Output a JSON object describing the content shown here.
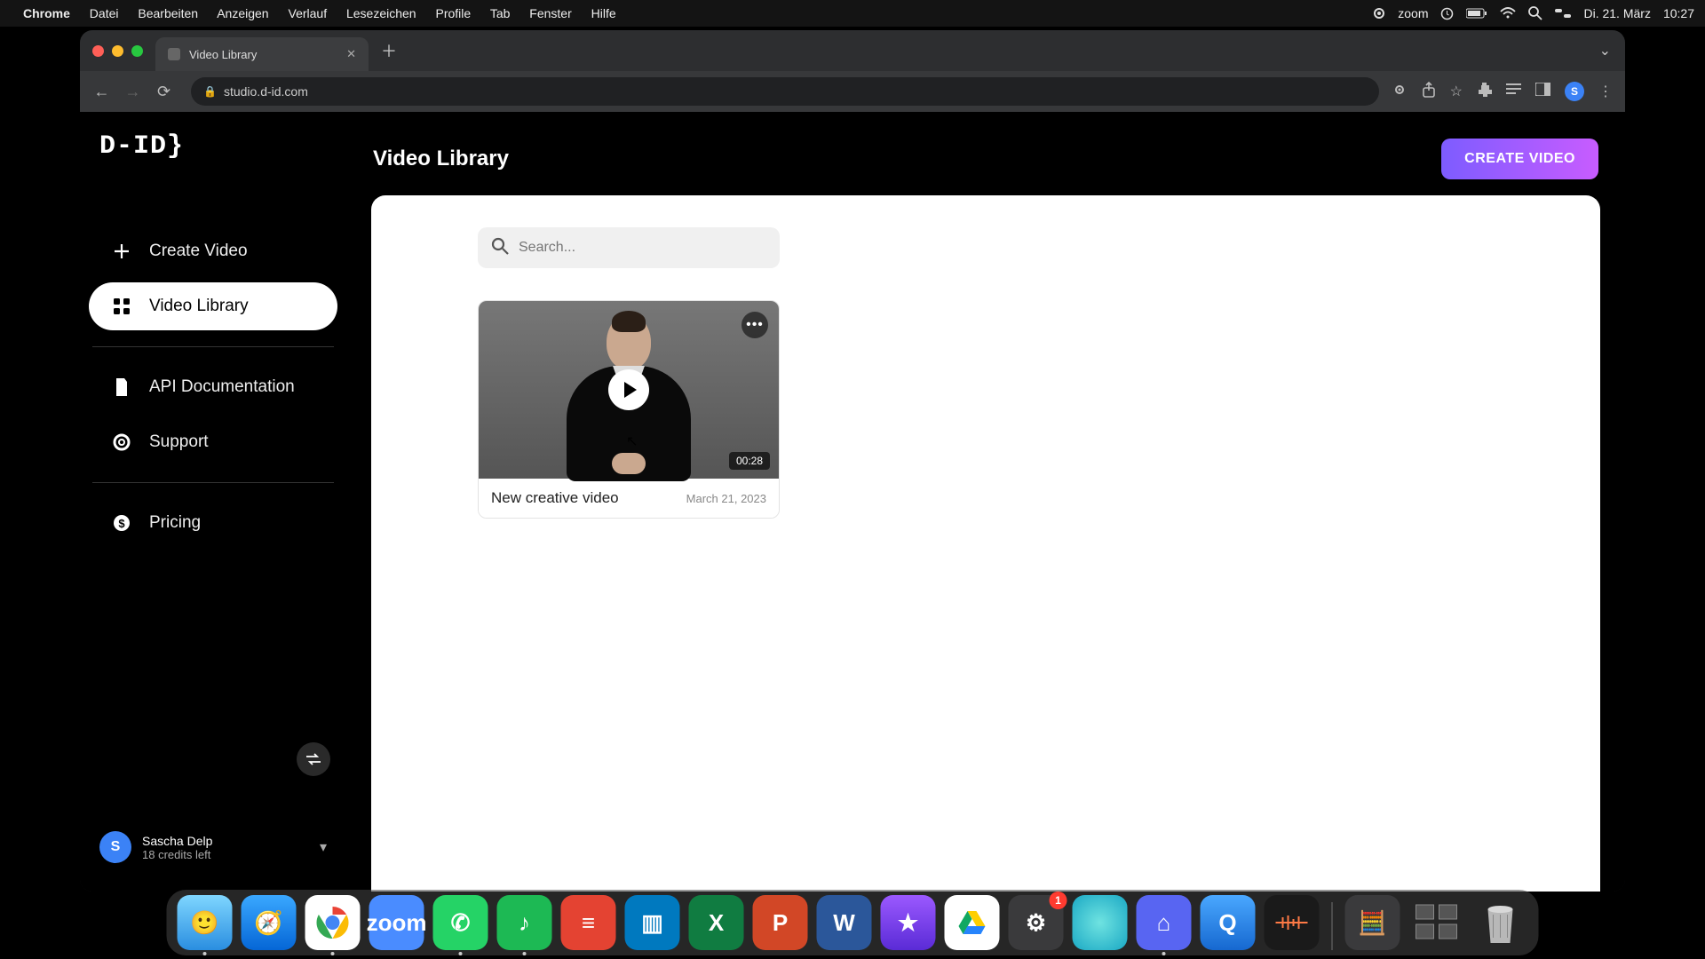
{
  "mac_menu": {
    "app": "Chrome",
    "items": [
      "Datei",
      "Bearbeiten",
      "Anzeigen",
      "Verlauf",
      "Lesezeichen",
      "Profile",
      "Tab",
      "Fenster",
      "Hilfe"
    ],
    "zoom_label": "zoom",
    "date": "Di. 21. März",
    "time": "10:27"
  },
  "browser": {
    "tab_title": "Video Library",
    "url": "studio.d-id.com",
    "avatar_letter": "S"
  },
  "app": {
    "logo": "D-ID}",
    "page_title": "Video Library",
    "create_button": "CREATE VIDEO",
    "nav": {
      "create_video": "Create Video",
      "video_library": "Video Library",
      "api_docs": "API Documentation",
      "support": "Support",
      "pricing": "Pricing"
    },
    "user": {
      "initial": "S",
      "name": "Sascha Delp",
      "credits": "18 credits left"
    },
    "search_placeholder": "Search...",
    "videos": [
      {
        "title": "New creative video",
        "date": "March 21, 2023",
        "duration": "00:28"
      }
    ]
  },
  "dock": {
    "settings_badge": "1"
  }
}
